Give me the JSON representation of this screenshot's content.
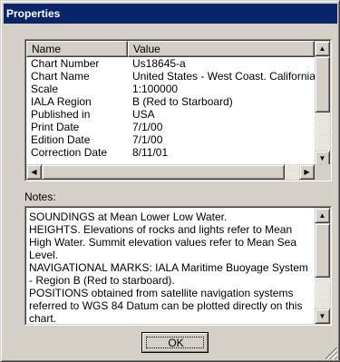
{
  "window": {
    "title": "Properties"
  },
  "list": {
    "columns": {
      "name": "Name",
      "value": "Value"
    },
    "rows": [
      {
        "name": "Chart Number",
        "value": "Us18645-a"
      },
      {
        "name": "Chart Name",
        "value": "United States - West Coast. California."
      },
      {
        "name": "Scale",
        "value": "1:100000"
      },
      {
        "name": "IALA Region",
        "value": "B (Red to Starboard)"
      },
      {
        "name": "Published in",
        "value": "USA"
      },
      {
        "name": "Print Date",
        "value": "7/1/00"
      },
      {
        "name": "Edition Date",
        "value": "7/1/00"
      },
      {
        "name": "Correction Date",
        "value": "8/11/01"
      }
    ]
  },
  "notes": {
    "label": "Notes:",
    "text": "SOUNDINGS at Mean Lower Low Water.\nHEIGHTS. Elevations of rocks and lights refer to Mean High Water. Summit elevation values refer to Mean Sea Level.\nNAVIGATIONAL MARKS: IALA Maritime Buoyage System - Region B (Red to starboard).\nPOSITIONS obtained from satellite navigation systems referred to WGS 84 Datum can be plotted directly on this chart."
  },
  "buttons": {
    "ok": "OK"
  },
  "icons": {
    "scroll_up": "arrow-up-icon",
    "scroll_down": "arrow-down-icon",
    "scroll_left": "arrow-left-icon",
    "scroll_right": "arrow-right-icon"
  }
}
